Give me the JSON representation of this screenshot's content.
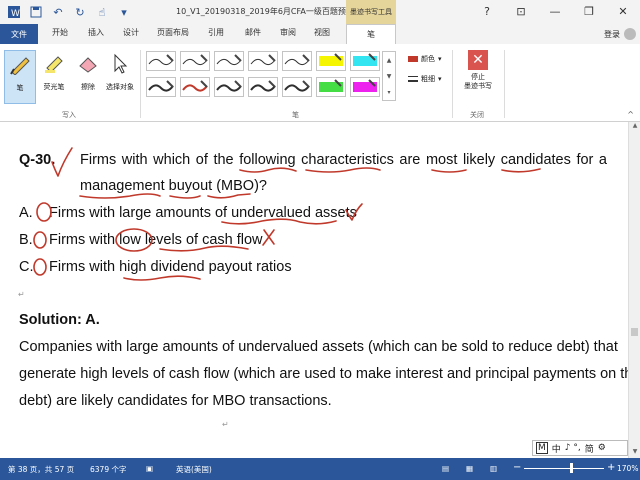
{
  "titlebar": {
    "doc_title": "10_V1_20190318_2019年6月CFA一级百题预...",
    "context_tab_label": "墨迹书写工具",
    "minimize": "—",
    "restore": "❐",
    "close": "✕",
    "ribbon_options": "⊡"
  },
  "tabs": {
    "file": "文件",
    "home": "开始",
    "insert": "插入",
    "design": "设计",
    "layout": "页面布局",
    "references": "引用",
    "mailings": "邮件",
    "review": "审阅",
    "view": "视图",
    "pens": "笔",
    "signin": "登录"
  },
  "ribbon": {
    "pen_label": "笔",
    "highlighter_label": "荧光笔",
    "eraser_label": "擦除",
    "select_label": "选择对象",
    "group_write": "写入",
    "group_pens": "笔",
    "color_label": "颜色",
    "thickness_label": "粗细",
    "stop_label_1": "停止",
    "stop_label_2": "墨迹书写",
    "group_close": "关闭",
    "pen_colors": [
      "#2f2f2f",
      "#2f2f2f",
      "#2f2f2f",
      "#2f2f2f",
      "#2f2f2f",
      "#f5f500",
      "#33e5f0",
      "#2f2f2f",
      "#c0392b",
      "#2f2f2f",
      "#2f2f2f",
      "#2f2f2f",
      "#44dd44",
      "#ee22ee"
    ]
  },
  "question": {
    "number": "Q-30.",
    "line1": "Firms with which of the following characteristics are most likely candidates for a",
    "line2": "management buyout (MBO)?",
    "option_a_letter": "A.",
    "option_a": "Firms with large amounts of undervalued assets",
    "option_b_letter": "B.",
    "option_b": "Firms with low levels of cash flow",
    "option_c_letter": "C.",
    "option_c": "Firms with high dividend payout ratios"
  },
  "solution": {
    "heading": "Solution: A.",
    "line1": "Companies with large amounts of undervalued assets (which can be sold to reduce debt) that",
    "line2": "generate high levels of cash flow (which are used to make interest and principal payments on the",
    "line3": "debt) are likely candidates for MBO transactions."
  },
  "annotations": {
    "ink_color": "#c0392b",
    "circle_a": "1",
    "circle_b": "0",
    "circle_c": "2",
    "cross": "X"
  },
  "ime": {
    "mode": "M",
    "lang": "中",
    "icons": "♪ °, ",
    "simplified": "简"
  },
  "status": {
    "page": "第 38 页，共 57 页",
    "words": "6379 个字",
    "language": "英语(美国)",
    "zoom_minus": "−",
    "zoom_plus": "+",
    "zoom": "170%",
    "zoom_level": 0.58
  }
}
